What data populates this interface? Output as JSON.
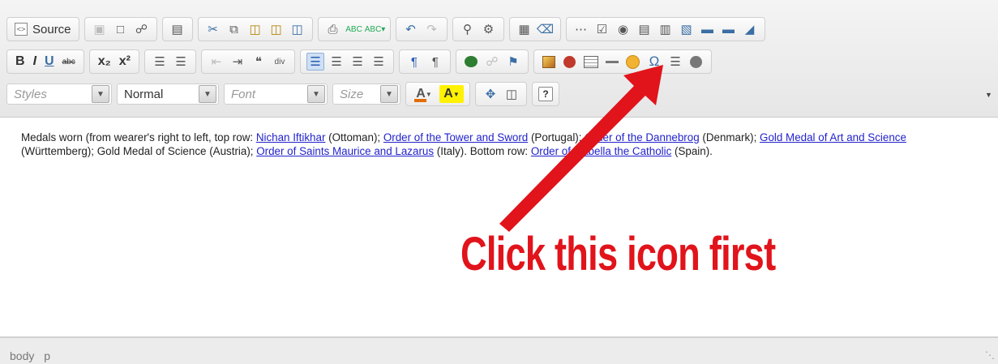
{
  "colors": {
    "accent_arrow": "#e1131b",
    "link": "#2222cc",
    "text_color_bar": "#e36c09",
    "bg_color_bar": "#fff200"
  },
  "toolbar": {
    "row1": [
      {
        "type": "source",
        "label": "Source",
        "icon": "source-icon"
      },
      {
        "type": "group",
        "icons": [
          "save-icon",
          "new-page-icon",
          "preview-icon"
        ]
      },
      {
        "type": "group",
        "icons": [
          "templates-icon"
        ]
      },
      {
        "type": "group",
        "icons": [
          "cut-icon",
          "copy-icon",
          "paste-icon",
          "paste-text-icon",
          "paste-word-icon"
        ]
      },
      {
        "type": "group",
        "icons": [
          "print-icon",
          "spellcheck-icon",
          "scayt-icon"
        ]
      },
      {
        "type": "group",
        "icons": [
          "undo-icon",
          "redo-icon"
        ]
      },
      {
        "type": "group",
        "icons": [
          "find-icon",
          "replace-icon"
        ]
      },
      {
        "type": "group",
        "icons": [
          "select-all-icon",
          "remove-format-icon"
        ]
      },
      {
        "type": "group",
        "icons": [
          "form-icon",
          "checkbox-icon",
          "radio-icon",
          "text-field-icon",
          "textarea-icon",
          "select-icon",
          "button-icon",
          "image-button-icon",
          "hidden-field-icon"
        ]
      }
    ],
    "row2_labels": {
      "bold": "B",
      "italic": "I",
      "underline": "U",
      "strike": "abc",
      "subscript": "x₂",
      "superscript": "x²"
    },
    "row3": {
      "styles_placeholder": "Styles",
      "format_value": "Normal",
      "font_placeholder": "Font",
      "size_placeholder": "Size",
      "text_color_label": "A",
      "bg_color_label": "A",
      "about_label": "?"
    }
  },
  "content": {
    "p1_before": "Medals worn (from wearer's right to left, top row: ",
    "link1": "Nichan Iftikhar",
    "p1_a": " (Ottoman); ",
    "link2": "Order of the Tower and Sword",
    "p1_b": " (Portugal); ",
    "link3": "Order of the Dannebrog",
    "p1_c": " (Denmark); ",
    "link4": "Gold Medal of Art and Science",
    "p1_d": " (Württemberg); Gold Medal of Science (Austria); ",
    "link5": "Order of Saints Maurice and Lazarus",
    "p1_e": " (Italy). Bottom row: ",
    "link6": "Order of Isabella the Catholic",
    "p1_f": " (Spain)."
  },
  "statusbar": {
    "path1": "body",
    "path2": "p"
  },
  "annotation": {
    "callout": "Click this icon first"
  }
}
